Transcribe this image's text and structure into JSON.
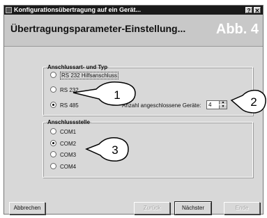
{
  "window": {
    "title": "Konfigurationsübertragung auf ein Gerät...",
    "help_label": "?",
    "close_label": "✕"
  },
  "header": {
    "title": "Übertragungsparameter-Einstellung...",
    "figure_label": "Abb. 4"
  },
  "connection_group": {
    "legend": "Anschlussart- und Typ",
    "options": [
      "RS 232 Hilfsanschluss",
      "RS 232",
      "RS 485"
    ],
    "selected_index": 2,
    "device_count_label": "Anzahl angeschlossene Geräte:",
    "device_count_value": "4"
  },
  "port_group": {
    "legend": "Anschlussstelle",
    "options": [
      "COM1",
      "COM2",
      "COM3",
      "COM4"
    ],
    "selected_index": 1
  },
  "buttons": {
    "cancel": "Abbrechen",
    "back": "Zurück",
    "next": "Nächster",
    "finish": "Ende"
  },
  "callouts": {
    "one": "1",
    "two": "2",
    "three": "3"
  },
  "colors": {
    "titlebar_bg": "#1a1a1a",
    "header_bg": "#c8c8c8",
    "dialog_bg": "#d8d8d8",
    "figure_label": "#ffffff"
  }
}
